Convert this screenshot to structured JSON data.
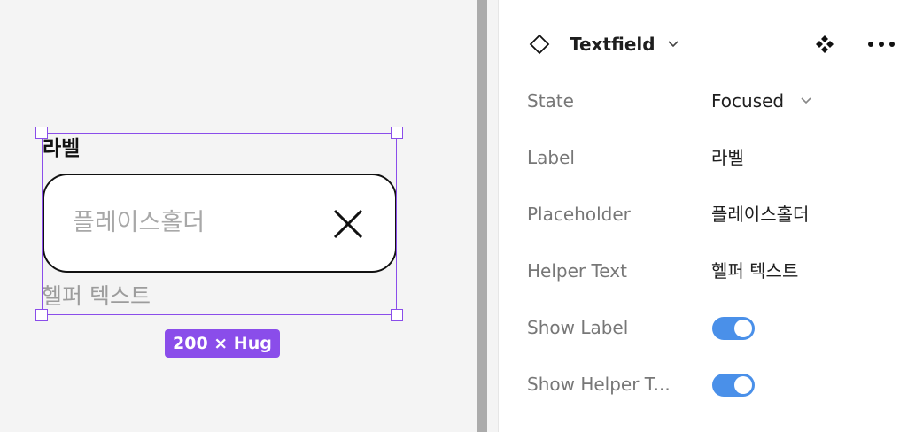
{
  "canvas": {
    "component": {
      "label": "라벨",
      "placeholder": "플레이스홀더",
      "helper_text": "헬퍼 텍스트"
    },
    "size_badge": "200 × Hug",
    "selection_color": "#8a4dea"
  },
  "panel": {
    "component_name": "Textfield",
    "properties": [
      {
        "label": "State",
        "value": "Focused",
        "kind": "select"
      },
      {
        "label": "Label",
        "value": "라벨",
        "kind": "text"
      },
      {
        "label": "Placeholder",
        "value": "플레이스홀더",
        "kind": "text"
      },
      {
        "label": "Helper Text",
        "value": "헬퍼 텍스트",
        "kind": "text"
      },
      {
        "label": "Show Label",
        "value": true,
        "kind": "toggle"
      },
      {
        "label": "Show Helper T...",
        "value": true,
        "kind": "toggle"
      }
    ],
    "toggle_on_color": "#4a90e9",
    "icons": {
      "component": "component-diamond-icon",
      "instance": "instance-icon",
      "more": "more-icon",
      "dropdown": "chevron-down-icon"
    }
  }
}
